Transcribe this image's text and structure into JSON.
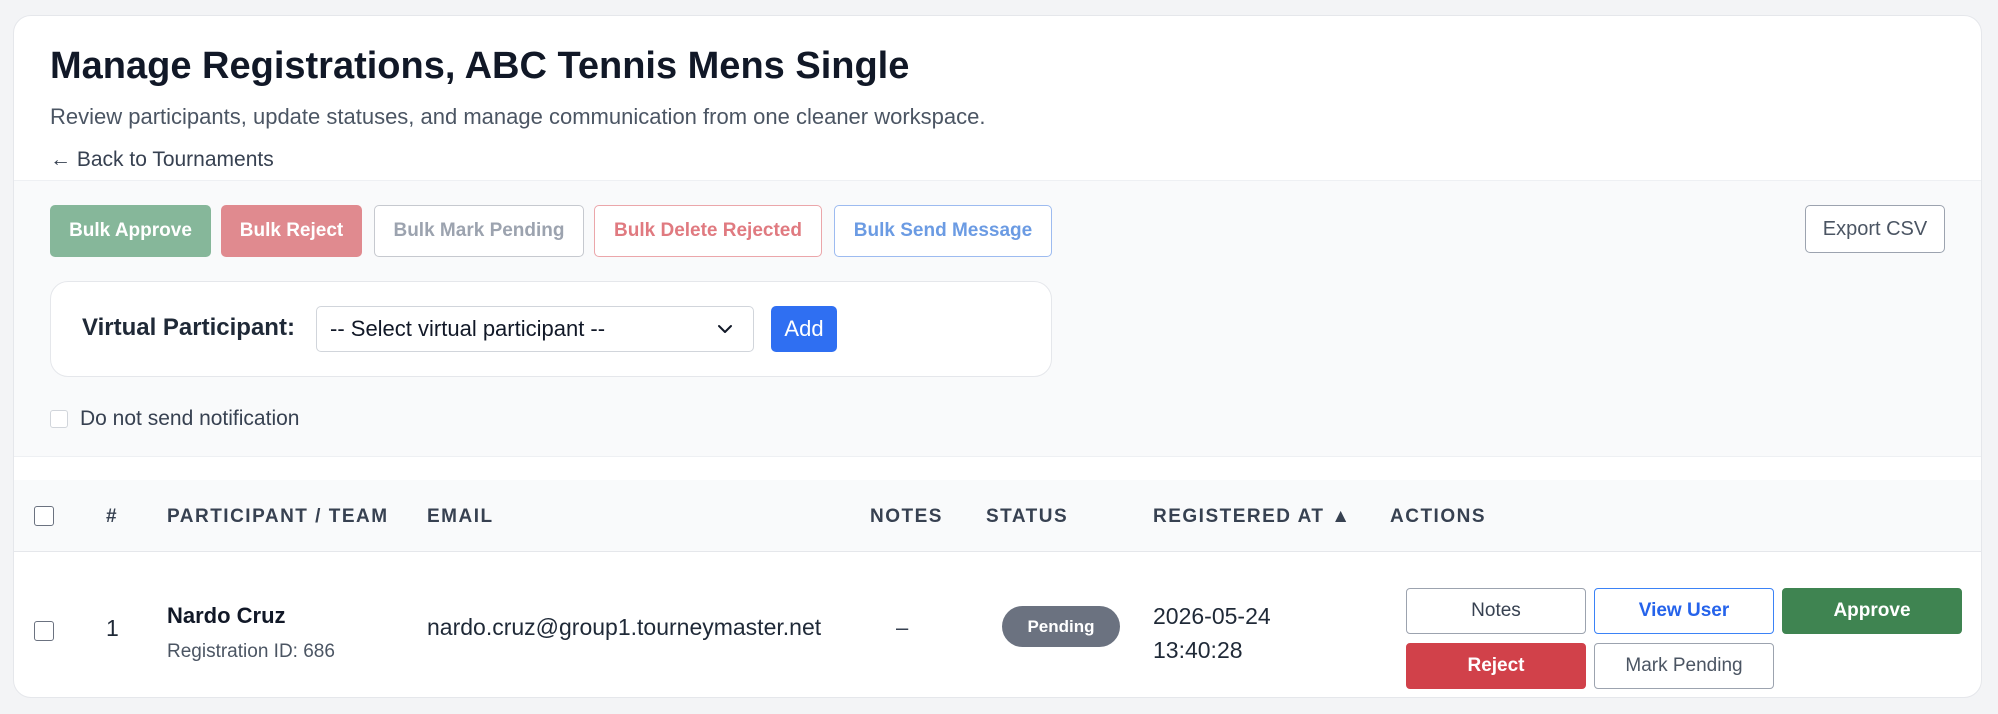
{
  "header": {
    "title": "Manage Registrations, ABC Tennis Mens Single",
    "subtitle": "Review participants, update statuses, and manage communication from one cleaner workspace.",
    "back_link": "← Back to Tournaments"
  },
  "toolbar": {
    "bulk_approve": "Bulk Approve",
    "bulk_reject": "Bulk Reject",
    "bulk_mark_pending": "Bulk Mark Pending",
    "bulk_delete_rejected": "Bulk Delete Rejected",
    "bulk_send_message": "Bulk Send Message",
    "export_csv": "Export CSV"
  },
  "virtual_participant": {
    "label": "Virtual Participant:",
    "select_value": "-- Select virtual participant --",
    "add_label": "Add"
  },
  "notify": {
    "label": "Do not send notification",
    "checked": false
  },
  "table": {
    "headers": {
      "num": "#",
      "participant": "PARTICIPANT / TEAM",
      "email": "EMAIL",
      "notes": "NOTES",
      "status": "STATUS",
      "registered": "REGISTERED AT ▲",
      "actions": "ACTIONS"
    },
    "rows": [
      {
        "num": "1",
        "name": "Nardo Cruz",
        "registration_id": "Registration ID: 686",
        "email": "nardo.cruz@group1.tourneymaster.net",
        "notes": "–",
        "status": "Pending",
        "registered_date": "2026-05-24",
        "registered_time": "13:40:28",
        "actions": {
          "notes": "Notes",
          "view_user": "View User",
          "approve": "Approve",
          "reject": "Reject",
          "mark_pending": "Mark Pending"
        }
      }
    ]
  },
  "colors": {
    "primary": "#2f6ff2",
    "approve": "#3f8451",
    "reject": "#d1414a",
    "pending_badge": "#6b7280"
  }
}
